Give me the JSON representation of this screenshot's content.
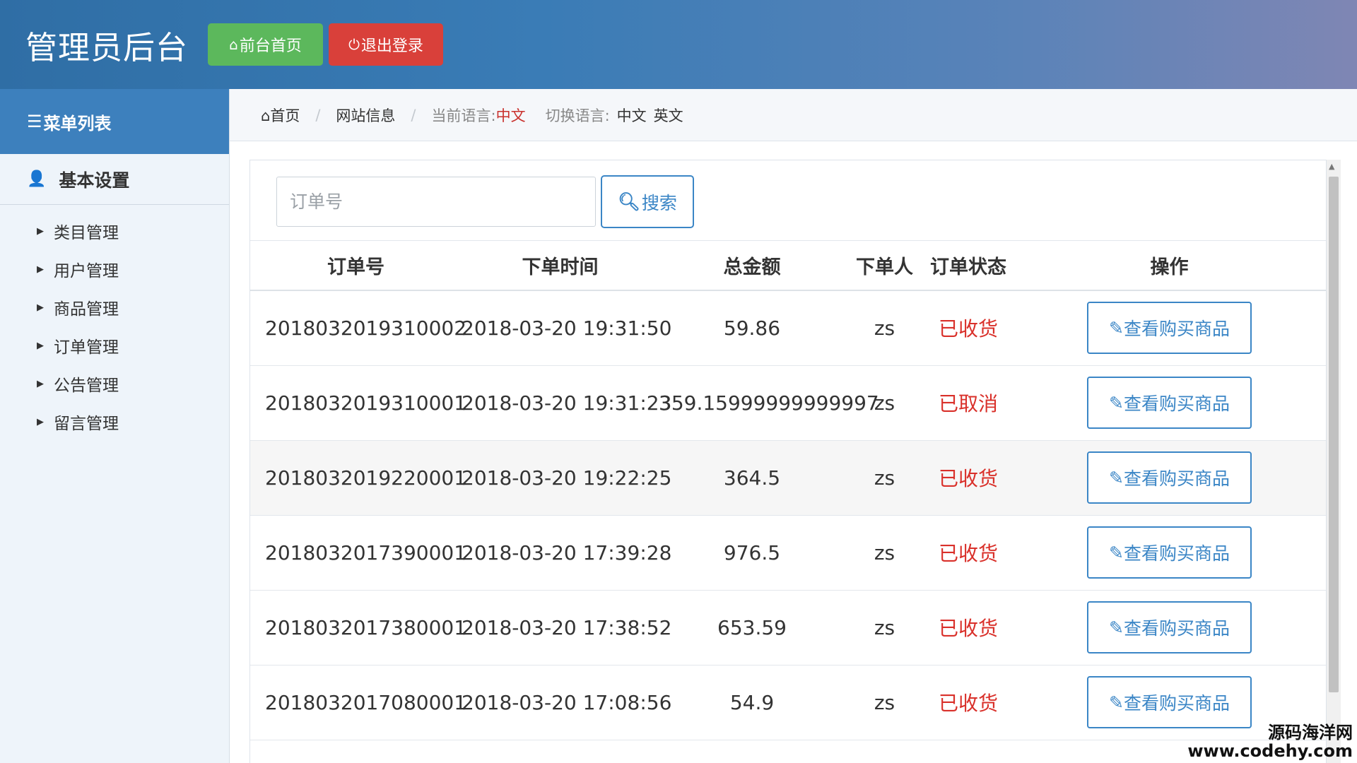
{
  "header": {
    "title": "管理员后台",
    "home_button": "前台首页",
    "logout_button": "退出登录"
  },
  "sidebar": {
    "heading": "菜单列表",
    "section": "基本设置",
    "items": [
      {
        "label": "类目管理"
      },
      {
        "label": "用户管理"
      },
      {
        "label": "商品管理"
      },
      {
        "label": "订单管理"
      },
      {
        "label": "公告管理"
      },
      {
        "label": "留言管理"
      }
    ]
  },
  "breadcrumb": {
    "home": "首页",
    "site_info": "网站信息",
    "current_lang_label": "当前语言:",
    "current_lang": "中文",
    "switch_lang_label": "切换语言:",
    "lang_zh": "中文",
    "lang_en": "英文"
  },
  "search": {
    "placeholder": "订单号",
    "button": "搜索"
  },
  "table": {
    "columns": [
      "订单号",
      "下单时间",
      "总金额",
      "下单人",
      "订单状态",
      "操作"
    ],
    "action_label": "查看购买商品",
    "rows": [
      {
        "order_no": "2018032019310002",
        "time": "2018-03-20 19:31:50",
        "amount": "59.86",
        "user": "zs",
        "status": "已收货"
      },
      {
        "order_no": "2018032019310001",
        "time": "2018-03-20 19:31:23",
        "amount": "359.15999999999997",
        "user": "zs",
        "status": "已取消"
      },
      {
        "order_no": "2018032019220001",
        "time": "2018-03-20 19:22:25",
        "amount": "364.5",
        "user": "zs",
        "status": "已收货"
      },
      {
        "order_no": "2018032017390001",
        "time": "2018-03-20 17:39:28",
        "amount": "976.5",
        "user": "zs",
        "status": "已收货"
      },
      {
        "order_no": "2018032017380001",
        "time": "2018-03-20 17:38:52",
        "amount": "653.59",
        "user": "zs",
        "status": "已收货"
      },
      {
        "order_no": "2018032017080001",
        "time": "2018-03-20 17:08:56",
        "amount": "54.9",
        "user": "zs",
        "status": "已收货"
      }
    ]
  },
  "watermark": {
    "line1": "源码海洋网",
    "line2": "www.codehy.com"
  }
}
